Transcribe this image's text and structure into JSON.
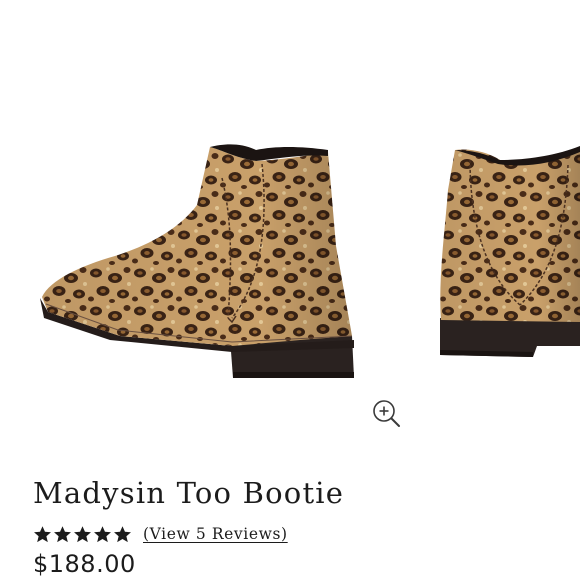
{
  "product": {
    "title": "Madysin Too Bootie",
    "rating": 5,
    "rating_max": 5,
    "reviews_link": "(View 5 Reviews)",
    "price": "$188.00"
  },
  "gallery": {
    "zoom_icon": "zoom-in-icon",
    "images": [
      "leopard-bootie-side",
      "leopard-bootie-back"
    ]
  },
  "colors": {
    "text": "#1c1c1c",
    "leopard_base": "#c9a06a",
    "leopard_spot": "#3a2315",
    "sole": "#2a2220"
  }
}
